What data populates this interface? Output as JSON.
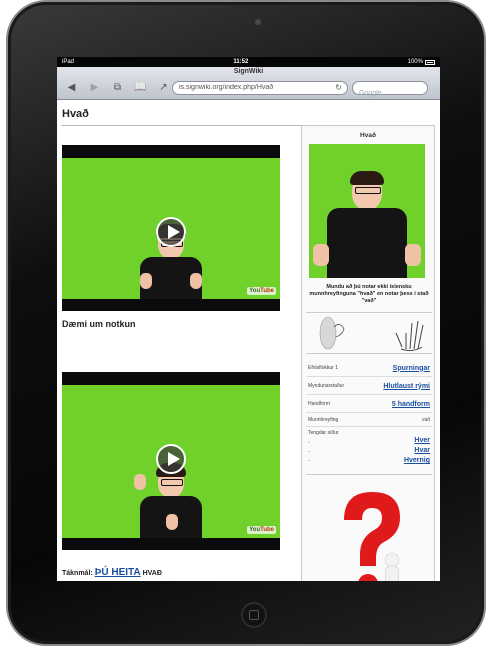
{
  "status_bar": {
    "carrier": "iPad",
    "time": "11:52",
    "battery": "100%"
  },
  "browser": {
    "page_title": "SignWiki",
    "url": "is.signwiki.org/index.php/Hvað",
    "search_placeholder": "Google"
  },
  "page": {
    "title": "Hvað",
    "section_heading": "Dæmi um notkun",
    "footer": {
      "prefix": "Táknmál:",
      "link": "ÞÚ HEITA",
      "suffix": "HVAÐ"
    }
  },
  "sidebar": {
    "title": "Hvað",
    "caption": "Mundu að þú notar ekki íslensku munnhreyfinguna \"hvað\" en notar þess í stað \"vað\"",
    "rows": [
      {
        "key": "Efnisflokkur 1",
        "value": "Spurningar"
      },
      {
        "key": "Myndunarstaður",
        "value": "Hlutlaust rými"
      },
      {
        "key": "Handform",
        "value": "5 handform"
      },
      {
        "key": "Munnhreyfing",
        "value": "vað"
      }
    ],
    "related": {
      "key": "Tengdar síður",
      "items": [
        "Hver",
        "Hvar",
        "Hvernig"
      ]
    }
  },
  "video": {
    "watermark_you": "You",
    "watermark_tube": "Tube"
  },
  "colors": {
    "green_screen": "#6fd12a",
    "link": "#1a4fa0",
    "question_mark": "#e01a1a"
  }
}
